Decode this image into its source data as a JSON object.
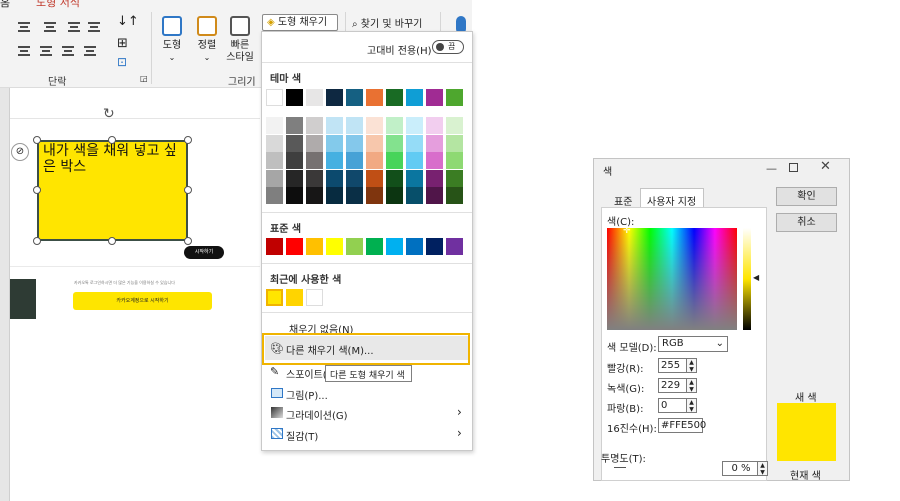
{
  "ribbon": {
    "tabs": [
      "홈",
      "도형 서식"
    ],
    "paragraph_group": "단락",
    "drawing_group": "그리기",
    "shape_btn": "도형",
    "arrange_btn": "정렬",
    "quick_style_btn": [
      "빠른",
      "스타일"
    ],
    "fill_btn": "도형 채우기",
    "find_replace": "찾기 및 바꾸기"
  },
  "slide": {
    "box_text": "내가 색을 채워 넣고 싶은 박스",
    "small_caption": "카카오톡 로그인하시면 더 많은 기능을 이용하실 수 있습니다",
    "login_button": "카카오계정으로 시작하기",
    "black_pill": "시작하기"
  },
  "fill_menu": {
    "high_contrast_label": "고대비 전용(H)",
    "high_contrast_toggle": "끔",
    "theme_title": "테마 색",
    "standard_title": "표준 색",
    "recent_title": "최근에 사용한 색",
    "no_fill": "채우기 없음(N)",
    "more_colors": "다른 채우기 색(M)...",
    "eyedropper": "스포이트(E)",
    "picture": "그림(P)...",
    "gradient": "그라데이션(G)",
    "texture": "질감(T)",
    "tooltip": "다른 도형 채우기 색",
    "theme_top": [
      "#FFFFFF",
      "#000000",
      "#E7E6E6",
      "#0E2841",
      "#156082",
      "#E97132",
      "#196B24",
      "#0F9ED5",
      "#A02B93",
      "#4EA72E"
    ],
    "theme_shades": [
      [
        "#F2F2F2",
        "#7F7F7F",
        "#D0CECE",
        "#C1E4F5",
        "#C0E4F5",
        "#FBE2D5",
        "#C1F0C8",
        "#CAEEFB",
        "#F2CEEF",
        "#D9F2D0"
      ],
      [
        "#D9D9D9",
        "#595959",
        "#AFABAB",
        "#83CAEB",
        "#84C8EB",
        "#F7C7AC",
        "#83E28E",
        "#95DCF7",
        "#E59EDD",
        "#B4E5A2"
      ],
      [
        "#BFBFBF",
        "#3F3F3F",
        "#767171",
        "#45B0E1",
        "#47A2D6",
        "#F1A983",
        "#47D45A",
        "#61CBF3",
        "#D86DCB",
        "#8ED973"
      ],
      [
        "#A6A6A6",
        "#262626",
        "#3A3838",
        "#0C4A6E",
        "#10486B",
        "#C04F15",
        "#124F1A",
        "#0B76A0",
        "#782170",
        "#3B7D23"
      ],
      [
        "#7F7F7F",
        "#0D0D0D",
        "#171616",
        "#072B40",
        "#0A2F46",
        "#7F350E",
        "#0C3511",
        "#074F6A",
        "#501549",
        "#275317"
      ]
    ],
    "standard_colors": [
      "#C00000",
      "#FF0000",
      "#FFC000",
      "#FFFF00",
      "#92D050",
      "#00B050",
      "#00B0F0",
      "#0070C0",
      "#002060",
      "#7030A0"
    ],
    "recent_colors": [
      "#FFE500",
      "#FFD400",
      "#FFFFFF"
    ]
  },
  "color_dialog": {
    "title": "색",
    "tab_standard": "표준",
    "tab_custom": "사용자 지정",
    "colors_label": "색(C):",
    "model_label": "색 모델(D):",
    "model_value": "RGB",
    "red_label": "빨강(R):",
    "red_value": "255",
    "green_label": "녹색(G):",
    "green_value": "229",
    "blue_label": "파랑(B):",
    "blue_value": "0",
    "hex_label": "16진수(H):",
    "hex_value": "#FFE500",
    "transparency_label": "투명도(T):",
    "transparency_value": "0 %",
    "ok": "확인",
    "cancel": "취소",
    "new_label": "새 색",
    "current_label": "현재 색",
    "new_color": "#FFE500",
    "current_color": "#FFE500"
  }
}
